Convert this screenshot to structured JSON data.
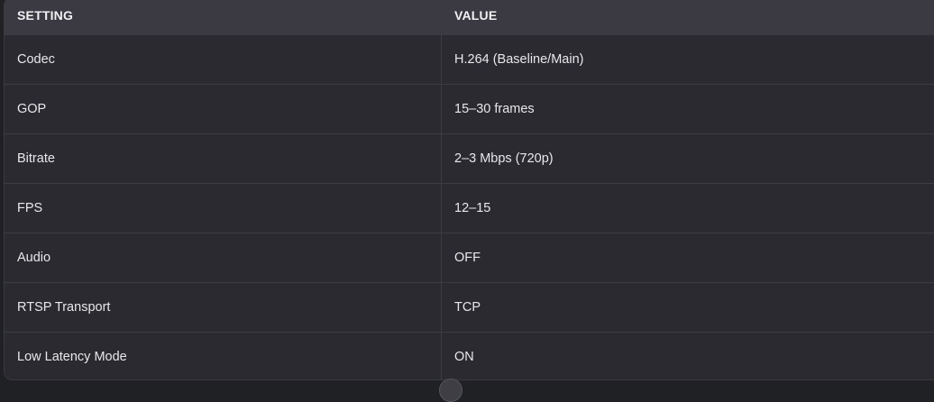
{
  "table": {
    "headers": {
      "setting": "SETTING",
      "value": "VALUE"
    },
    "rows": [
      {
        "setting": "Codec",
        "value": "H.264 (Baseline/Main)"
      },
      {
        "setting": "GOP",
        "value": "15–30 frames"
      },
      {
        "setting": "Bitrate",
        "value": "2–3 Mbps (720p)"
      },
      {
        "setting": "FPS",
        "value": "12–15"
      },
      {
        "setting": "Audio",
        "value": "OFF"
      },
      {
        "setting": "RTSP Transport",
        "value": "TCP"
      },
      {
        "setting": "Low Latency Mode",
        "value": "ON"
      }
    ]
  },
  "colors": {
    "background": "#2b2a30",
    "header_background": "#3b3a42",
    "text": "#e8e8ea"
  }
}
